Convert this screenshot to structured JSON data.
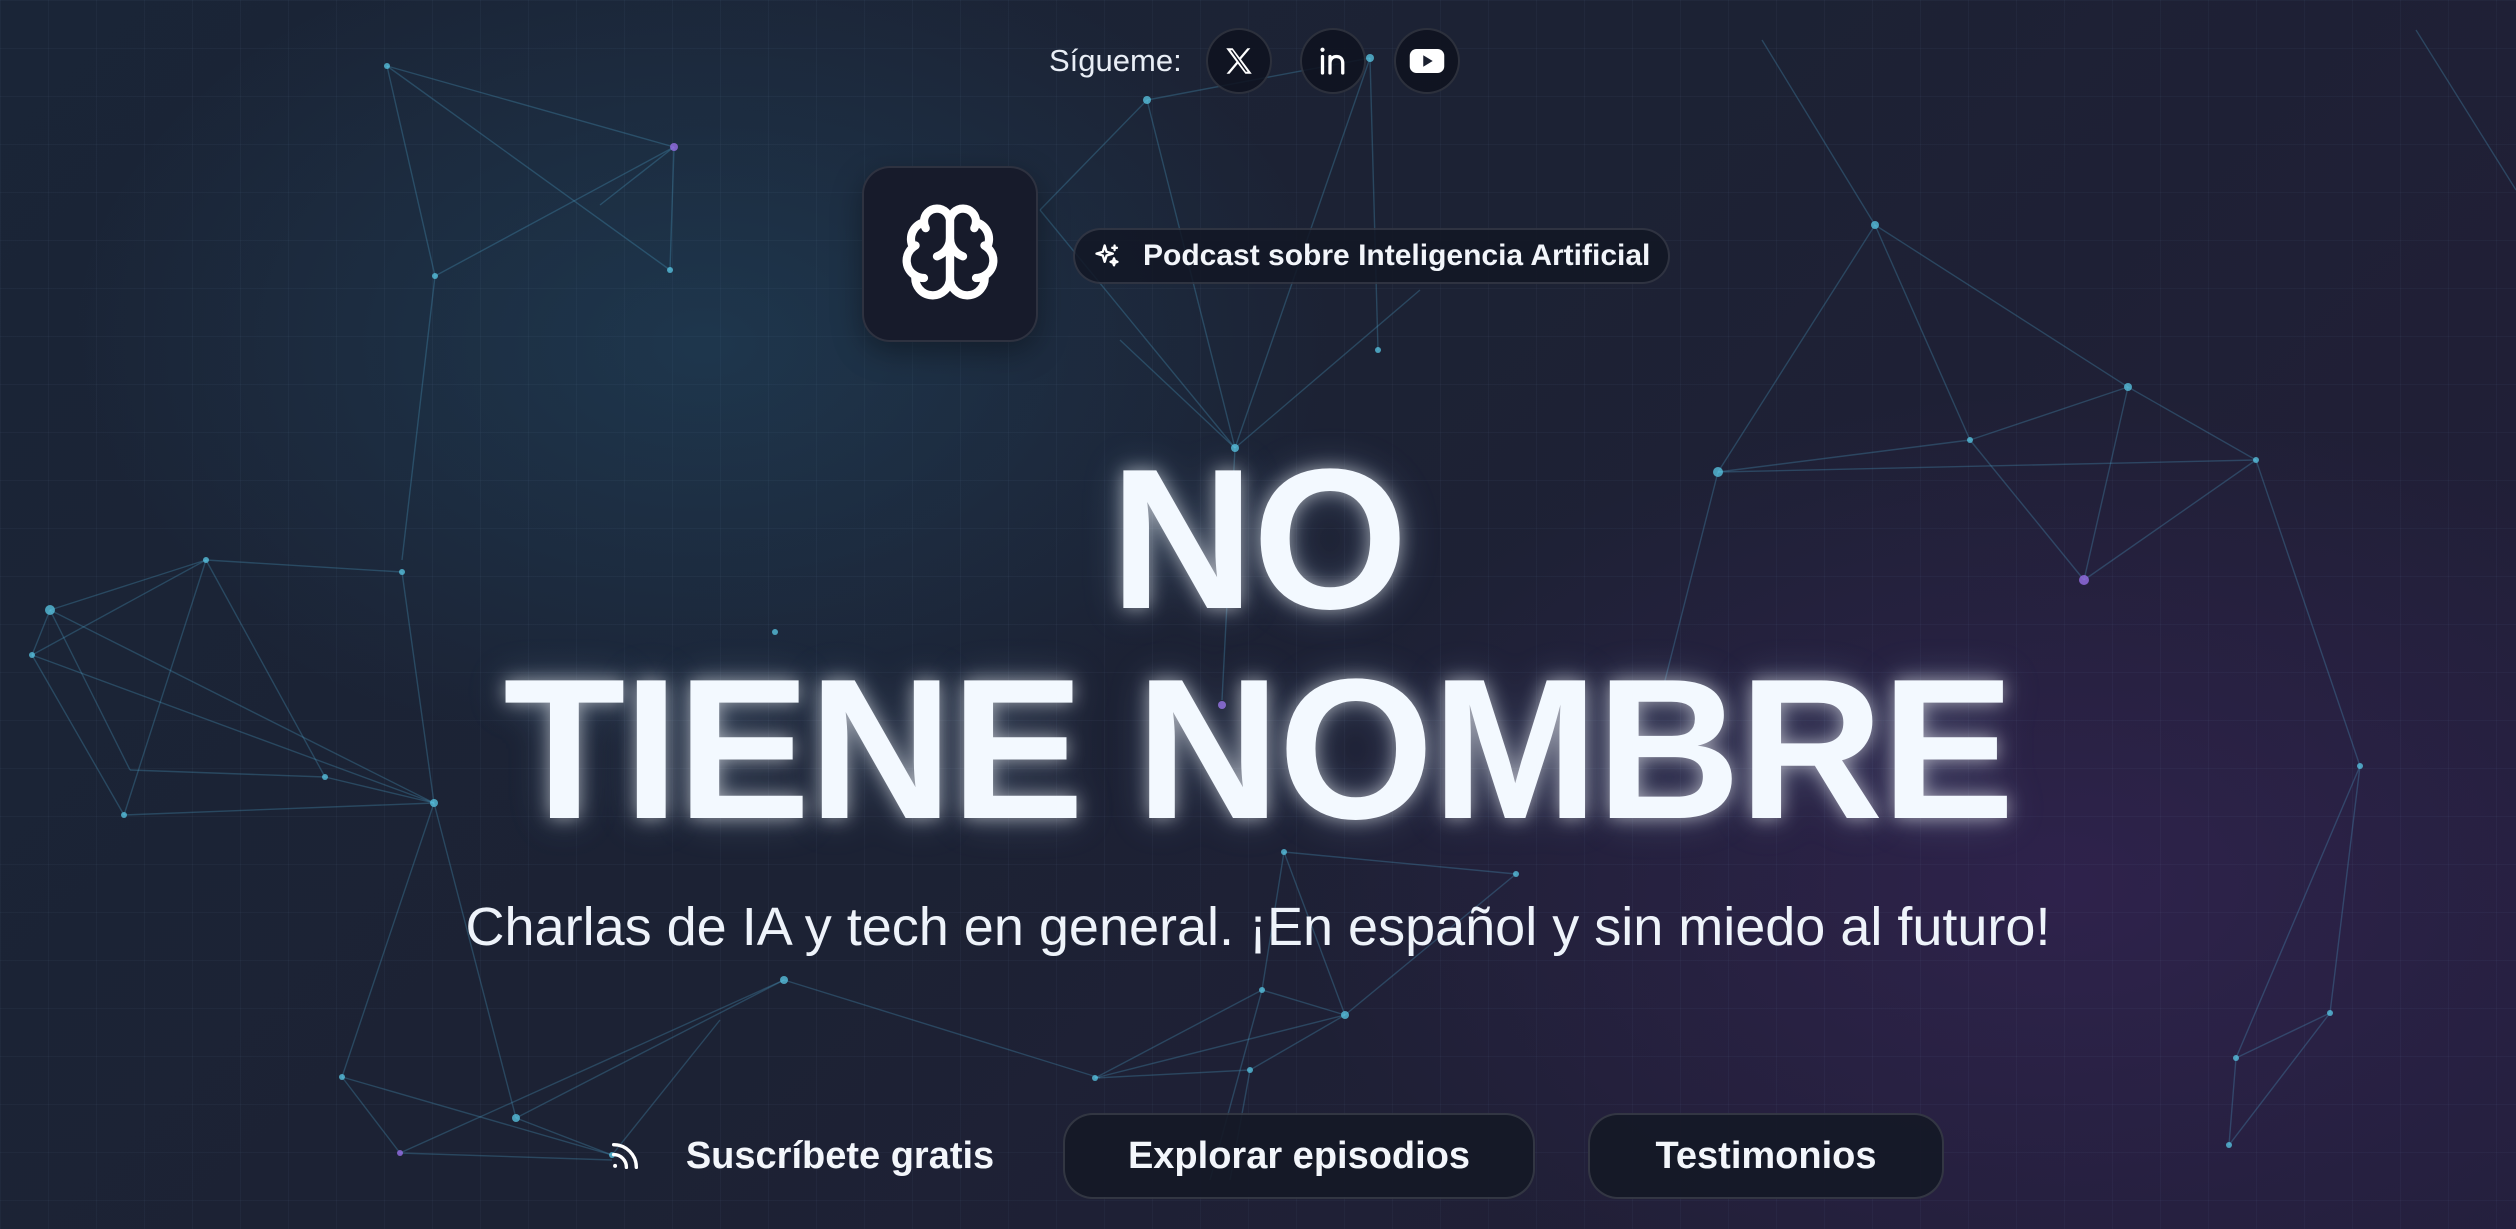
{
  "social": {
    "label": "Sígueme:",
    "links": [
      {
        "name": "X",
        "icon": "x-icon"
      },
      {
        "name": "LinkedIn",
        "icon": "linkedin-icon"
      },
      {
        "name": "YouTube",
        "icon": "youtube-icon"
      }
    ]
  },
  "logo": {
    "icon": "brain-icon"
  },
  "badge": {
    "icon": "sparkle-icon",
    "label": "Podcast sobre Inteligencia Artificial"
  },
  "hero": {
    "title_line1": "NO",
    "title_line2": "TIENE NOMBRE",
    "tagline": "Charlas de IA y tech en general. ¡En español y sin miedo al futuro!"
  },
  "actions": {
    "subscribe_label": "Suscríbete gratis",
    "subscribe_icon": "rss-icon",
    "explore_label": "Explorar episodios",
    "testimonials_label": "Testimonios"
  },
  "colors": {
    "background": "#1c2234",
    "text": "#f3f8ff",
    "network_lines": "#50aad2",
    "button_bg": "#141826"
  }
}
